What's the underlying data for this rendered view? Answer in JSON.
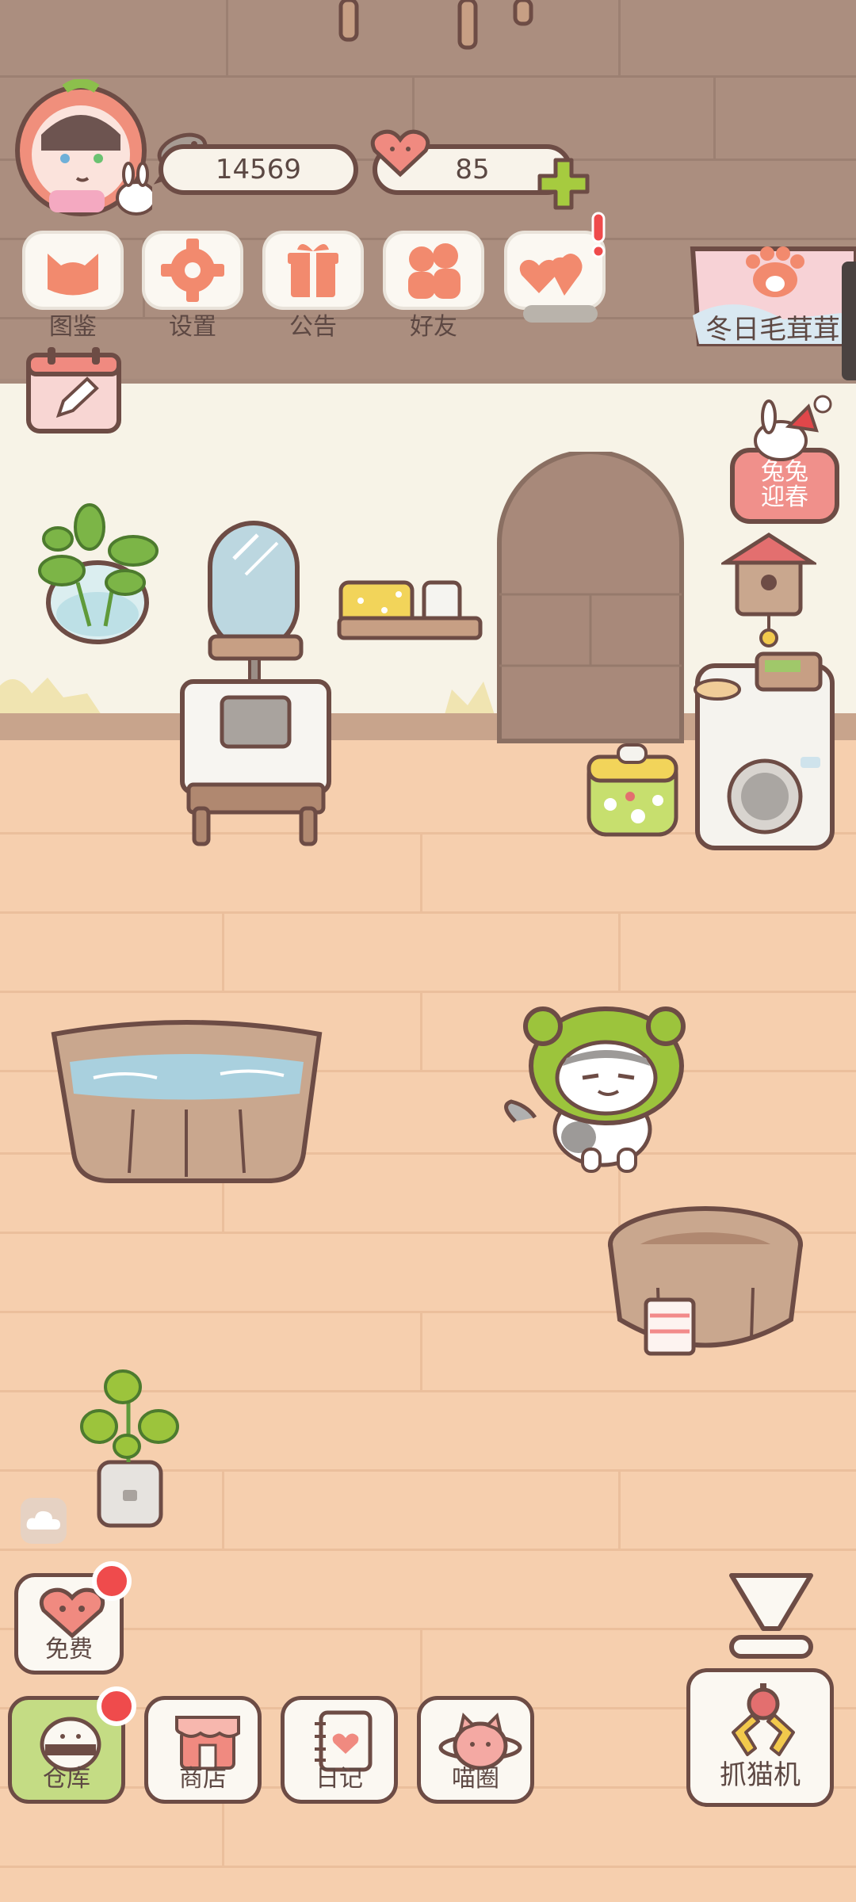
{
  "resources": {
    "fish_count": "14569",
    "heart_count": "85"
  },
  "menu": {
    "guide": "图鉴",
    "settings": "设置",
    "notice": "公告",
    "friends": "好友"
  },
  "events": {
    "winter_event": "冬日毛茸茸",
    "rabbit_line1": "兔兔",
    "rabbit_line2": "迎春"
  },
  "bottom": {
    "free": "免费",
    "warehouse": "仓库",
    "shop": "商店",
    "diary": "日记",
    "circle": "喵圈",
    "claw": "抓猫机"
  },
  "colors": {
    "accent_red": "#ef4b4c",
    "icon_coral": "#f28a6e",
    "frame_brown": "#6d4c45",
    "green": "#9fcb52"
  }
}
